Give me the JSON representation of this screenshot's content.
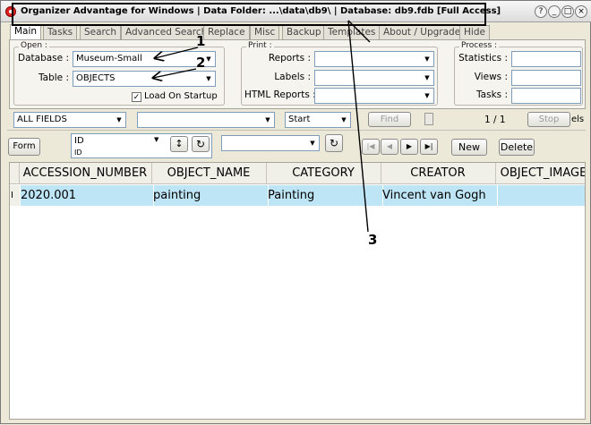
{
  "window": {
    "title": "Organizer Advantage for Windows | Data Folder: ...\\data\\db9\\ | Database: db9.fdb [Full Access]",
    "controls": [
      "?",
      "_",
      "□",
      "×"
    ]
  },
  "tabs": [
    "Main",
    "Tasks",
    "Search",
    "Advanced Search",
    "Replace",
    "Misc",
    "Backup",
    "Templates",
    "About / Upgrade",
    "Hide"
  ],
  "open_group": {
    "label": "Open :",
    "database_label": "Database :",
    "database_value": "Museum-Small",
    "table_label": "Table :",
    "table_value": "OBJECTS",
    "load_on_startup": "Load On Startup"
  },
  "print_group": {
    "label": "Print :",
    "reports_label": "Reports :",
    "labels_label": "Labels :",
    "html_reports_label": "HTML Reports :"
  },
  "process_group": {
    "label": "Process :",
    "statistics_label": "Statistics :",
    "views_label": "Views :",
    "tasks_label": "Tasks :"
  },
  "search_bar": {
    "field_value": "ALL FIELDS",
    "search_value": "",
    "mode_value": "Start",
    "find_label": "Find",
    "page_count": "1 / 1",
    "stop_label": "Stop",
    "trailing": "els"
  },
  "toolbar": {
    "form_label": "Form",
    "sort_field": "ID",
    "sort_sub": "ID",
    "filter_value": "",
    "new_label": "New",
    "delete_label": "Delete"
  },
  "grid": {
    "columns": [
      "ACCESSION_NUMBER",
      "OBJECT_NAME",
      "CATEGORY",
      "CREATOR",
      "OBJECT_IMAGE"
    ],
    "row_marker": "I",
    "rows": [
      [
        "2020.001",
        "painting",
        "Painting",
        "Vincent van Gogh",
        ""
      ]
    ]
  },
  "annotations": {
    "one": "1",
    "two": "2",
    "three": "3"
  },
  "icons": [
    "app-icon",
    "help-icon",
    "minimize-icon",
    "maximize-icon",
    "close-icon",
    "dropdown-arrow-icon",
    "first-record-icon",
    "prev-record-icon",
    "next-record-icon",
    "last-record-icon",
    "sort-toggle-icon",
    "refresh-icon"
  ]
}
